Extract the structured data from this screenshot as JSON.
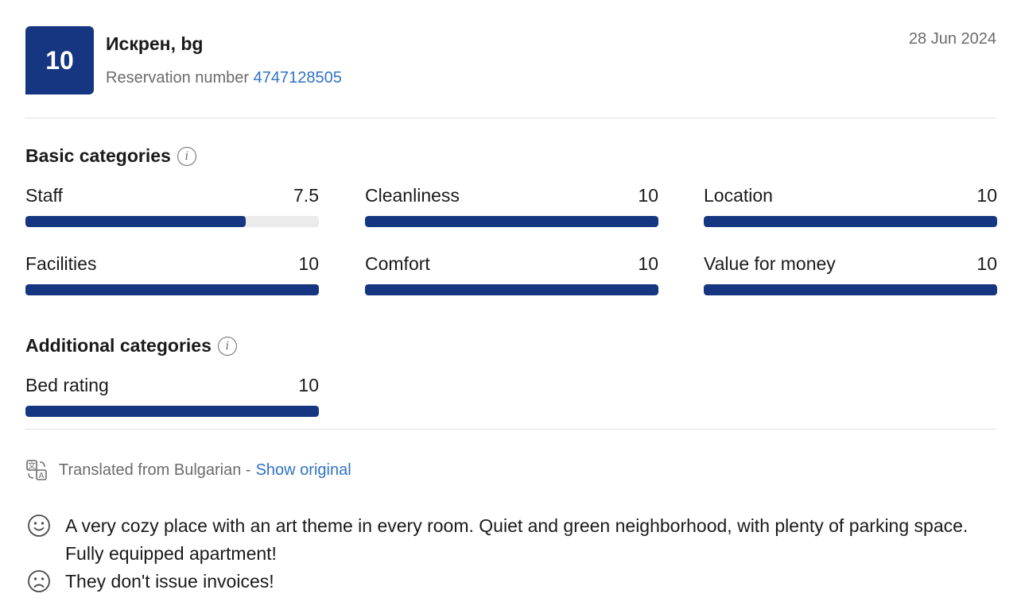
{
  "review": {
    "score": "10",
    "reviewer": "Искрен, bg",
    "reservation_label": "Reservation number",
    "reservation_number": "4747128505",
    "date": "28 Jun 2024"
  },
  "basic": {
    "title": "Basic categories",
    "items": [
      {
        "label": "Staff",
        "value": "7.5",
        "fraction": 0.75
      },
      {
        "label": "Cleanliness",
        "value": "10",
        "fraction": 1
      },
      {
        "label": "Location",
        "value": "10",
        "fraction": 1
      },
      {
        "label": "Facilities",
        "value": "10",
        "fraction": 1
      },
      {
        "label": "Comfort",
        "value": "10",
        "fraction": 1
      },
      {
        "label": "Value for money",
        "value": "10",
        "fraction": 1
      }
    ]
  },
  "additional": {
    "title": "Additional categories",
    "items": [
      {
        "label": "Bed rating",
        "value": "10",
        "fraction": 1
      }
    ]
  },
  "translation": {
    "text": "Translated from Bulgarian -",
    "link": "Show original"
  },
  "comments": {
    "positive": "A very cozy place with an art theme in every room. Quiet and green neighborhood, with plenty of parking space. Fully equipped apartment!",
    "negative": "They don't issue invoices!"
  },
  "colors": {
    "brand": "#163681",
    "link": "#2f72c4",
    "track": "#ebebeb"
  },
  "icons": {
    "info": "info-icon",
    "translate": "translate-icon",
    "positive": "smiley-face-icon",
    "negative": "sad-face-icon"
  }
}
